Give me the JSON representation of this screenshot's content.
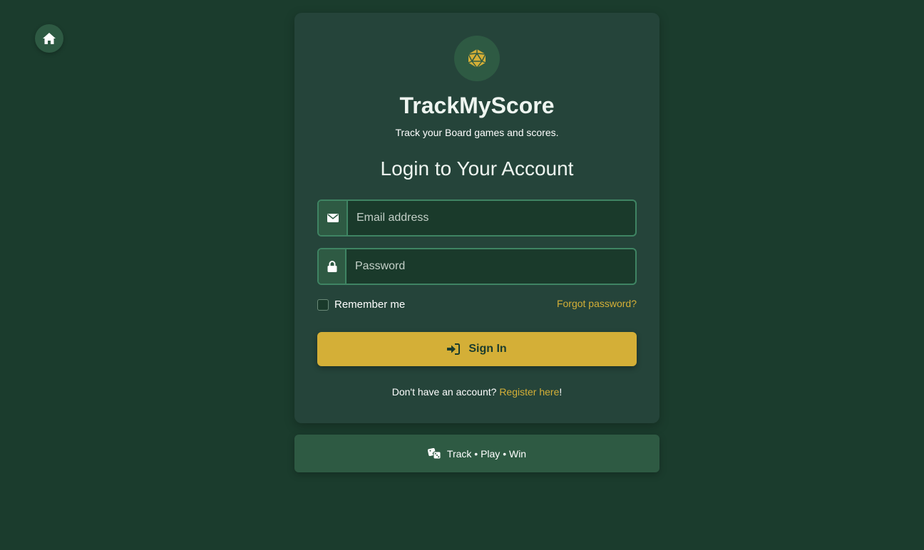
{
  "nav": {
    "home_icon": "home-icon"
  },
  "brand": {
    "logo_icon": "d20-dice-icon",
    "title": "TrackMyScore",
    "subtitle": "Track your Board games and scores."
  },
  "login": {
    "heading": "Login to Your Account",
    "email": {
      "icon": "envelope-icon",
      "placeholder": "Email address",
      "value": ""
    },
    "password": {
      "icon": "lock-icon",
      "placeholder": "Password",
      "value": ""
    },
    "remember_label": "Remember me",
    "remember_checked": false,
    "forgot_label": "Forgot password?",
    "signin_icon": "sign-in-icon",
    "signin_label": "Sign In",
    "register_prompt": "Don't have an account?",
    "register_link": "Register here",
    "register_suffix": "!"
  },
  "footer": {
    "icon": "dice-icon",
    "tagline": "Track • Play • Win"
  },
  "colors": {
    "background": "#1b3c2d",
    "card": "#25443a",
    "accent": "#d4af37",
    "input_border": "#3f8463",
    "addon": "#2e5a43"
  }
}
